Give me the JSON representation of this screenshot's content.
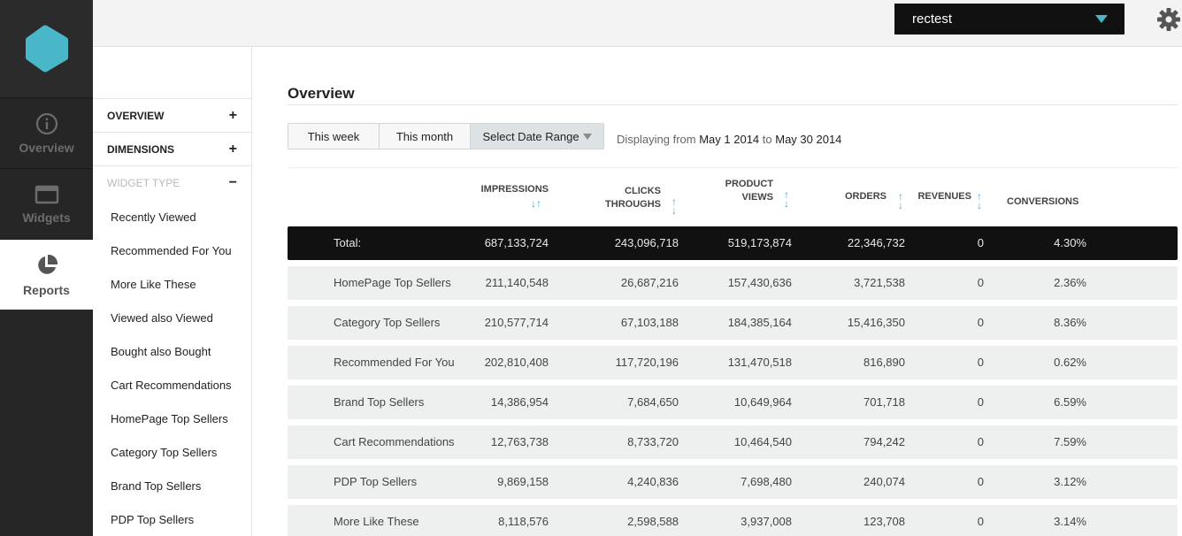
{
  "rail": {
    "items": [
      {
        "label": "Overview",
        "icon": "info-circle-icon"
      },
      {
        "label": "Widgets",
        "icon": "window-icon"
      },
      {
        "label": "Reports",
        "icon": "pie-chart-icon"
      }
    ],
    "logo_color": "#4ab7c8"
  },
  "topbar": {
    "account": "rectest"
  },
  "panel": {
    "overview_label": "OVERVIEW",
    "dimensions_label": "DIMENSIONS",
    "widget_type_label": "WIDGET TYPE",
    "plus": "+",
    "minus": "−",
    "widgets": [
      "Recently Viewed",
      "Recommended For You",
      "More Like These",
      "Viewed also Viewed",
      "Bought also Bought",
      "Cart Recommendations",
      "HomePage Top Sellers",
      "Category Top Sellers",
      "Brand Top Sellers",
      "PDP Top Sellers"
    ]
  },
  "main": {
    "title": "Overview",
    "date_tabs": [
      "This week",
      "This month",
      "Select Date Range"
    ],
    "displaying_prefix": "Displaying from",
    "date_from": "May 1 2014",
    "date_to_word": "to",
    "date_to": "May 30 2014",
    "columns": {
      "impressions": "IMPRESSIONS",
      "clicks_1": "CLICKS",
      "clicks_2": "THROUGHS",
      "pviews_1": "PRODUCT",
      "pviews_2": "VIEWS",
      "orders": "ORDERS",
      "revenues": "REVENUES",
      "conversions": "CONVERSIONS"
    },
    "sort_up": "↑",
    "sort_down": "↓",
    "rows": [
      {
        "name": "Total:",
        "impressions": "687,133,724",
        "clicks": "243,096,718",
        "views": "519,173,874",
        "orders": "22,346,732",
        "revenues": "0",
        "conversions": "4.30%"
      },
      {
        "name": "HomePage Top Sellers",
        "impressions": "211,140,548",
        "clicks": "26,687,216",
        "views": "157,430,636",
        "orders": "3,721,538",
        "revenues": "0",
        "conversions": "2.36%"
      },
      {
        "name": "Category Top Sellers",
        "impressions": "210,577,714",
        "clicks": "67,103,188",
        "views": "184,385,164",
        "orders": "15,416,350",
        "revenues": "0",
        "conversions": "8.36%"
      },
      {
        "name": "Recommended For You",
        "impressions": "202,810,408",
        "clicks": "117,720,196",
        "views": "131,470,518",
        "orders": "816,890",
        "revenues": "0",
        "conversions": "0.62%"
      },
      {
        "name": "Brand Top Sellers",
        "impressions": "14,386,954",
        "clicks": "7,684,650",
        "views": "10,649,964",
        "orders": "701,718",
        "revenues": "0",
        "conversions": "6.59%"
      },
      {
        "name": "Cart Recommendations",
        "impressions": "12,763,738",
        "clicks": "8,733,720",
        "views": "10,464,540",
        "orders": "794,242",
        "revenues": "0",
        "conversions": "7.59%"
      },
      {
        "name": "PDP Top Sellers",
        "impressions": "9,869,158",
        "clicks": "4,240,836",
        "views": "7,698,480",
        "orders": "240,074",
        "revenues": "0",
        "conversions": "3.12%"
      },
      {
        "name": "More Like These",
        "impressions": "8,118,576",
        "clicks": "2,598,588",
        "views": "3,937,008",
        "orders": "123,708",
        "revenues": "0",
        "conversions": "3.14%"
      }
    ]
  }
}
